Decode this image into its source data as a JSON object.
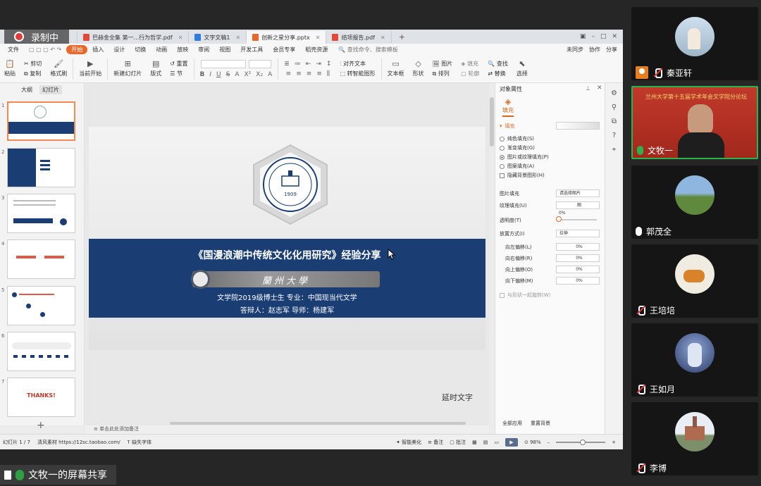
{
  "recording": {
    "label": "录制中"
  },
  "tabs": [
    {
      "label": "巴赫金全集 第一...行为哲学.pdf",
      "color": "#e0483a"
    },
    {
      "label": "文字文稿1",
      "color": "#2f7de1"
    },
    {
      "label": "创新之星分享.pptx",
      "color": "#e8692c",
      "active": true
    },
    {
      "label": "结项报告.pdf",
      "color": "#e0483a"
    }
  ],
  "menu": {
    "file": "文件",
    "items": [
      "开始",
      "插入",
      "设计",
      "切换",
      "动画",
      "放映",
      "审阅",
      "视图",
      "开发工具",
      "会员专享",
      "稻壳资源"
    ],
    "search": "查找命令、搜索模板",
    "right": [
      "未同步",
      "协作",
      "分享"
    ]
  },
  "ribbon": {
    "paste": "粘贴",
    "cut": "剪切",
    "copy": "复制",
    "format_painter": "格式刷",
    "from_current": "当前开始",
    "new_slide": "新建幻灯片",
    "layout": "版式",
    "section": "节",
    "reset": "重置",
    "align_text": "对齐文本",
    "smart_graphic": "转智能图形",
    "textbox": "文本框",
    "shape": "形状",
    "arrange": "排列",
    "picture": "图片",
    "fill": "填充",
    "outline": "轮廓",
    "find": "查找",
    "replace": "替换",
    "select": "选择"
  },
  "leftpane": {
    "tab_outline": "大纲",
    "tab_slides": "幻灯片",
    "slide_count": 7,
    "thanks_text": "THANKS!"
  },
  "slide": {
    "title": "《国漫浪潮中传统文化化用研究》经验分享",
    "name_plate": "蘭州大學",
    "line1": "文学院2019级博士生      专业：中国现当代文学",
    "line2": "答辩人：赵志军    导师：杨建军",
    "badge_year": "1909",
    "badge_text": "LANZHOU UNIVERSITY"
  },
  "delay_text": "延时文字",
  "notes_placeholder": "单击此处添加备注",
  "props": {
    "title": "对象属性",
    "fill_tab": "填充",
    "fill_label": "填充",
    "options": [
      "纯色填充(S)",
      "渐变填充(G)",
      "图片或纹理填充(P)",
      "图案填充(A)",
      "隐藏背景图形(H)"
    ],
    "selected_option": 2,
    "pic_fill_label": "图片填充",
    "pic_fill_value": "请选择图片",
    "texture_label": "纹理填充(U)",
    "texture_value": "图",
    "transparency_label": "透明度(T)",
    "transparency_value": "0%",
    "place_label": "放置方式(I)",
    "place_value": "拉伸",
    "offsets": [
      {
        "label": "向左偏移(L)",
        "value": "0%"
      },
      {
        "label": "向右偏移(R)",
        "value": "0%"
      },
      {
        "label": "向上偏移(O)",
        "value": "0%"
      },
      {
        "label": "向下偏移(M)",
        "value": "0%"
      }
    ],
    "rotate_with_shape": "与形状一起旋转(W)",
    "apply_all": "全部应用",
    "reset_bg": "重置背景"
  },
  "status": {
    "slide_pos": "幻灯片 1 / 7",
    "theme": "清风素材 https://12sc.taobao.com/",
    "font_missing": "缺失字体",
    "smart_beautify": "智能美化",
    "notes": "备注",
    "comments": "批注",
    "zoom": "98%"
  },
  "share_label": "文牧一的屏幕共享",
  "participants": [
    {
      "name": "秦亚轩",
      "mic": "off",
      "host": true,
      "bg": "#9fb6c8"
    },
    {
      "name": "文牧一",
      "mic": "on",
      "active": true,
      "banner": "兰州大学第十五届学术年会文学院分论坛",
      "bg": "#c0392b"
    },
    {
      "name": "郭茂全",
      "mic": "on",
      "bg": "#6b9bc8"
    },
    {
      "name": "王培培",
      "mic": "off",
      "bg": "#f1ece2"
    },
    {
      "name": "王如月",
      "mic": "off",
      "bg": "#3d4f7a"
    },
    {
      "name": "李博",
      "mic": "off",
      "bg": "#dde3ea"
    }
  ],
  "colors": {
    "accent": "#e8692c",
    "slide_band": "#1a3e74",
    "mic_on": "#2bb24c",
    "mic_off": "#e03a3a"
  }
}
